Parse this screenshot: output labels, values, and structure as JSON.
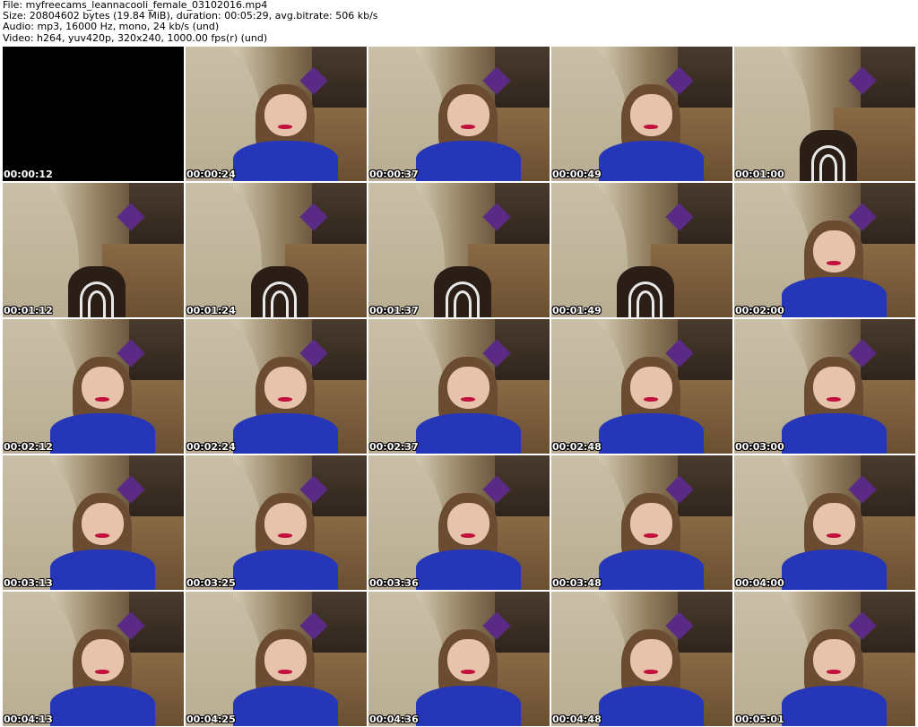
{
  "header": {
    "file_line": "File: myfreecams_leannacooli_female_03102016.mp4",
    "size_line": "Size: 20804602 bytes (19.84 MiB), duration: 00:05:29, avg.bitrate: 506 kb/s",
    "audio_line": "Audio: mp3, 16000 Hz, mono, 24 kb/s (und)",
    "video_line": "Video: h264, yuv420p, 320x240, 1000.00 fps(r) (und)"
  },
  "thumbnails": [
    {
      "timestamp": "00:00:12",
      "scene": "black"
    },
    {
      "timestamp": "00:00:24",
      "scene": "person"
    },
    {
      "timestamp": "00:00:37",
      "scene": "person"
    },
    {
      "timestamp": "00:00:49",
      "scene": "person"
    },
    {
      "timestamp": "00:01:00",
      "scene": "chair"
    },
    {
      "timestamp": "00:01:12",
      "scene": "chair"
    },
    {
      "timestamp": "00:01:24",
      "scene": "chair"
    },
    {
      "timestamp": "00:01:37",
      "scene": "chair"
    },
    {
      "timestamp": "00:01:49",
      "scene": "chair"
    },
    {
      "timestamp": "00:02:00",
      "scene": "person"
    },
    {
      "timestamp": "00:02:12",
      "scene": "person"
    },
    {
      "timestamp": "00:02:24",
      "scene": "person"
    },
    {
      "timestamp": "00:02:37",
      "scene": "person"
    },
    {
      "timestamp": "00:02:48",
      "scene": "person"
    },
    {
      "timestamp": "00:03:00",
      "scene": "person"
    },
    {
      "timestamp": "00:03:13",
      "scene": "person"
    },
    {
      "timestamp": "00:03:25",
      "scene": "person"
    },
    {
      "timestamp": "00:03:36",
      "scene": "person"
    },
    {
      "timestamp": "00:03:48",
      "scene": "person"
    },
    {
      "timestamp": "00:04:00",
      "scene": "person"
    },
    {
      "timestamp": "00:04:13",
      "scene": "person"
    },
    {
      "timestamp": "00:04:25",
      "scene": "person"
    },
    {
      "timestamp": "00:04:36",
      "scene": "person"
    },
    {
      "timestamp": "00:04:48",
      "scene": "person"
    },
    {
      "timestamp": "00:05:01",
      "scene": "person"
    }
  ]
}
